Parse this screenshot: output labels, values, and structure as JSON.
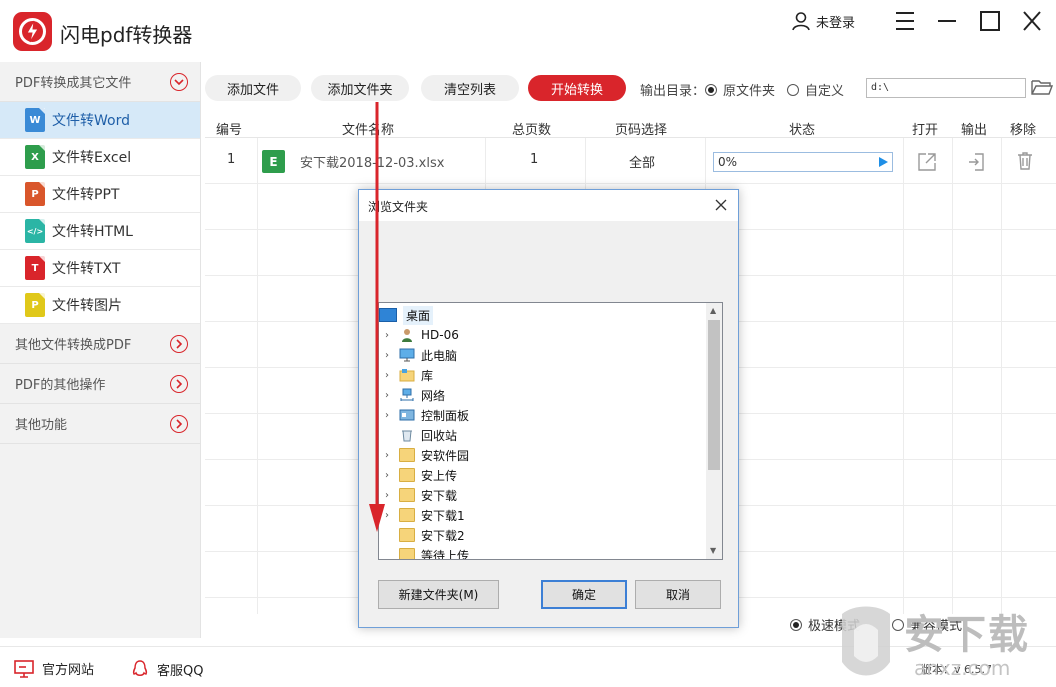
{
  "app": {
    "title": "闪电pdf转换器",
    "user_label": "未登录"
  },
  "sidebar": {
    "section_main": "PDF转换成其它文件",
    "items": [
      {
        "label": "文件转Word",
        "icon": "W",
        "color": "#3a8ad6"
      },
      {
        "label": "文件转Excel",
        "icon": "X",
        "color": "#2e9d4c"
      },
      {
        "label": "文件转PPT",
        "icon": "P",
        "color": "#d9562b"
      },
      {
        "label": "文件转HTML",
        "icon": "</>",
        "color": "#2bb5a5"
      },
      {
        "label": "文件转TXT",
        "icon": "T",
        "color": "#d9252b"
      },
      {
        "label": "文件转图片",
        "icon": "P",
        "color": "#e0c81a"
      }
    ],
    "sections": [
      "其他文件转换成PDF",
      "PDF的其他操作",
      "其他功能"
    ]
  },
  "toolbar": {
    "add_file": "添加文件",
    "add_folder": "添加文件夹",
    "clear_list": "清空列表",
    "start": "开始转换",
    "output_label": "输出目录：",
    "opt_original": "原文件夹",
    "opt_custom": "自定义",
    "path": "d:\\"
  },
  "table": {
    "headers": [
      "编号",
      "文件名称",
      "总页数",
      "页码选择",
      "状态",
      "打开",
      "输出",
      "移除"
    ],
    "rows": [
      {
        "num": "1",
        "icon": "E",
        "name": "安下载2018-12-03.xlsx",
        "pages": "1",
        "range": "全部",
        "status": "0%"
      }
    ]
  },
  "modes": {
    "fast": "极速模式",
    "compat": "兼容模式"
  },
  "footer": {
    "website": "官方网站",
    "qq": "客服QQ",
    "version": "版本：v 6.5.7"
  },
  "dialog": {
    "title": "浏览文件夹",
    "tree": [
      {
        "label": "桌面",
        "icon": "desktop-icon",
        "expand": false
      },
      {
        "label": "HD-06",
        "icon": "user-icon",
        "expand": true
      },
      {
        "label": "此电脑",
        "icon": "computer-icon",
        "expand": true
      },
      {
        "label": "库",
        "icon": "library-icon",
        "expand": true
      },
      {
        "label": "网络",
        "icon": "network-icon",
        "expand": true
      },
      {
        "label": "控制面板",
        "icon": "control-panel-icon",
        "expand": true
      },
      {
        "label": "回收站",
        "icon": "recycle-bin-icon",
        "expand": false
      },
      {
        "label": "安软件园",
        "icon": "folder-icon",
        "expand": true
      },
      {
        "label": "安上传",
        "icon": "folder-icon",
        "expand": true
      },
      {
        "label": "安下载",
        "icon": "folder-icon",
        "expand": true
      },
      {
        "label": "安下载1",
        "icon": "folder-icon",
        "expand": true
      },
      {
        "label": "安下载2",
        "icon": "folder-icon",
        "expand": false
      },
      {
        "label": "等待上传",
        "icon": "folder-icon",
        "expand": false
      }
    ],
    "new_folder": "新建文件夹(M)",
    "ok": "确定",
    "cancel": "取消"
  },
  "watermark": {
    "text": "安下载",
    "url": "anxz.com"
  }
}
